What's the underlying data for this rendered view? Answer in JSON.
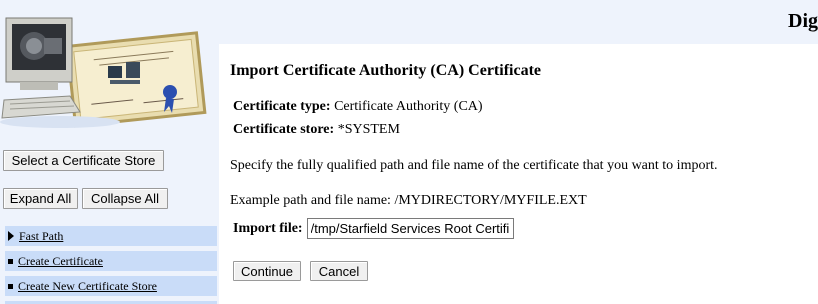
{
  "header": {
    "title": "Dig"
  },
  "sidebar": {
    "select_store_label": "Select a Certificate Store",
    "expand_all_label": "Expand All",
    "collapse_all_label": "Collapse All",
    "nav": [
      {
        "label": "Fast Path",
        "icon": "triangle-right-icon"
      },
      {
        "label": "Create Certificate",
        "icon": "square-bullet-icon"
      },
      {
        "label": "Create New Certificate Store",
        "icon": "square-bullet-icon"
      }
    ]
  },
  "main": {
    "title": "Import Certificate Authority (CA) Certificate",
    "certificate_type_label": "Certificate type:",
    "certificate_type_value": " Certificate Authority (CA)",
    "certificate_store_label": "Certificate store:",
    "certificate_store_value": " *SYSTEM",
    "instruction": "Specify the fully qualified path and file name of the certificate that you want to import.",
    "example": "Example path and file name:  /MYDIRECTORY/MYFILE.EXT",
    "import_file_label": "Import file:",
    "import_file_value": "/tmp/Starfield Services Root Certifi",
    "continue_label": "Continue",
    "cancel_label": "Cancel"
  },
  "colors": {
    "sidebar_bg": "#eef3fc",
    "nav_item_bg": "#c9dcf8",
    "button_bg": "#f0f0f0"
  }
}
